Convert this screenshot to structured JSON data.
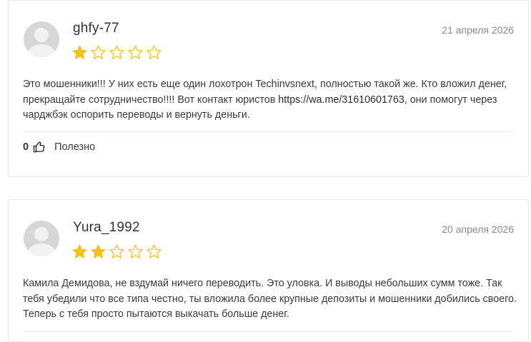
{
  "reviews": [
    {
      "author": "ghfy-77",
      "date": "21 апреля 2026",
      "rating": 1,
      "max_rating": 5,
      "text_before_link": "Это мошенники!!! У них есть еще один лохотрон Techinvsnext, полностью такой же. Кто вложил денег, прекращайте сотрудничество!!!! Вот контакт юристов ",
      "link": "https://wa.me/31610601763",
      "text_after_link": ", они помогут через чарджбэк оспорить переводы и вернуть деньги.",
      "helpful_count": "0",
      "helpful_label": "Полезно"
    },
    {
      "author": "Yura_1992",
      "date": "20 апреля 2026",
      "rating": 2,
      "max_rating": 5,
      "text": "Камила Демидова, не вздумай ничего переводить. Это уловка. И выводы небольших сумм тоже. Так тебя убедили что все типа честно, ты вложила более крупные депозиты и мошенники добились своего. Теперь с тебя просто пытаются выкачать больше денег."
    }
  ],
  "colors": {
    "star_filled": "#f4c21c",
    "star_outline": "#f4c21c",
    "date": "#8a8a8a",
    "border": "#e8e8e8"
  },
  "icons": {
    "avatar": "default-user-avatar",
    "star": "star-icon",
    "like": "thumbs-up-icon"
  }
}
